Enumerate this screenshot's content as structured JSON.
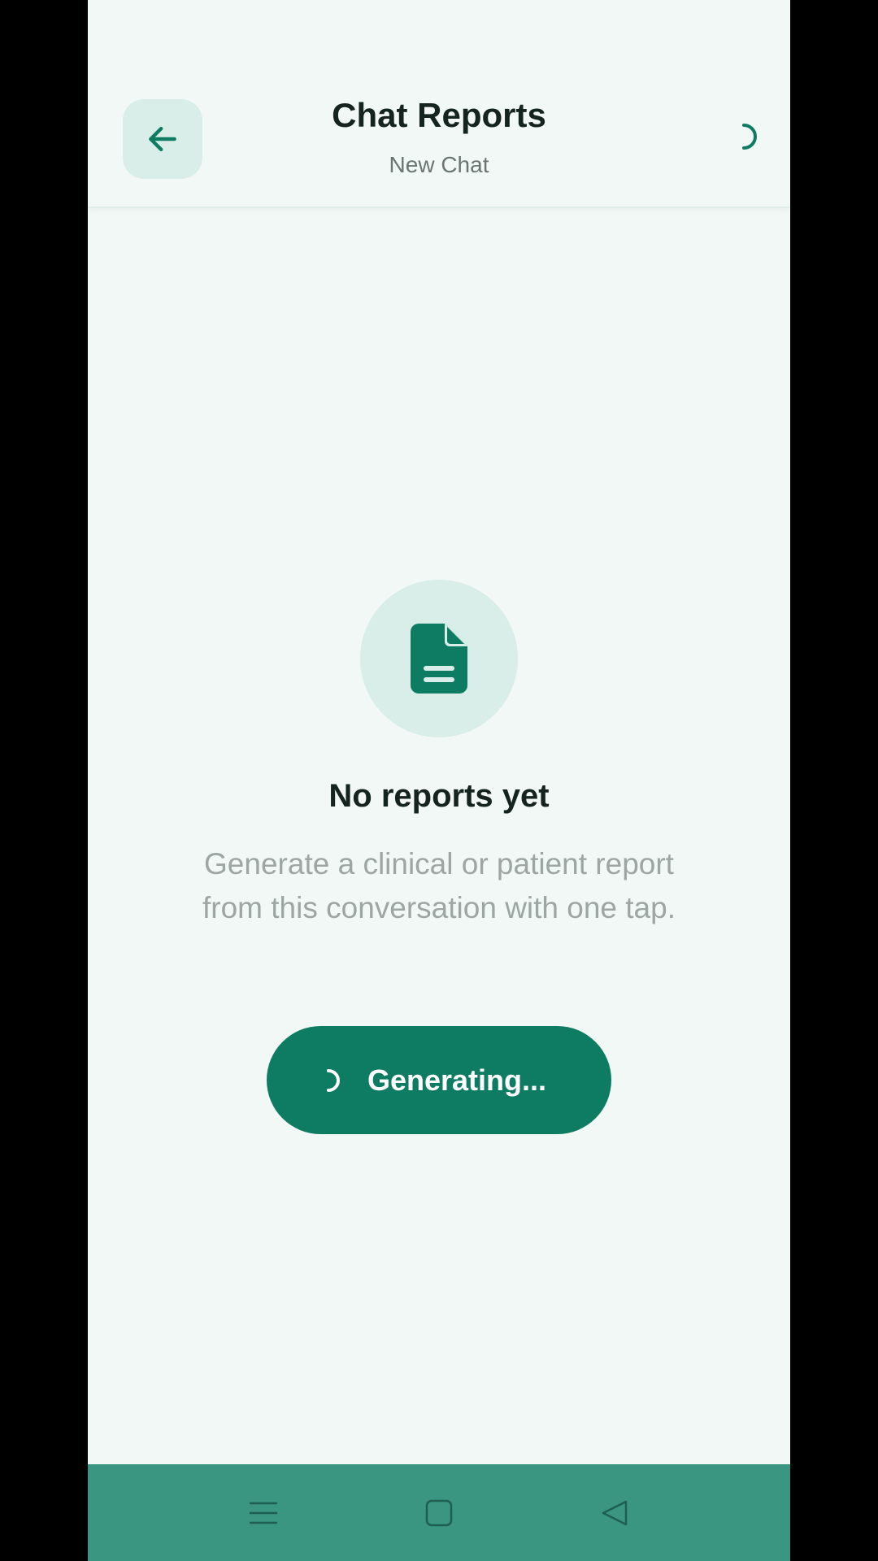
{
  "header": {
    "title": "Chat Reports",
    "subtitle": "New Chat"
  },
  "empty_state": {
    "icon": "document-icon",
    "title": "No reports yet",
    "description": "Generate a clinical or patient report from this conversation with one tap."
  },
  "generate_button": {
    "label": "Generating..."
  },
  "icons": {
    "back": "arrow-left-icon",
    "header_status": "loading-spinner-icon",
    "nav_menu": "menu-icon",
    "nav_home": "square-icon",
    "nav_back": "triangle-back-icon"
  },
  "colors": {
    "accent": "#0e7c63",
    "accent_light": "#d9eee8",
    "background": "#f2f8f6",
    "nav_bar": "#3a9680",
    "title_text": "#16241f",
    "muted_text": "#9ea6a3"
  }
}
